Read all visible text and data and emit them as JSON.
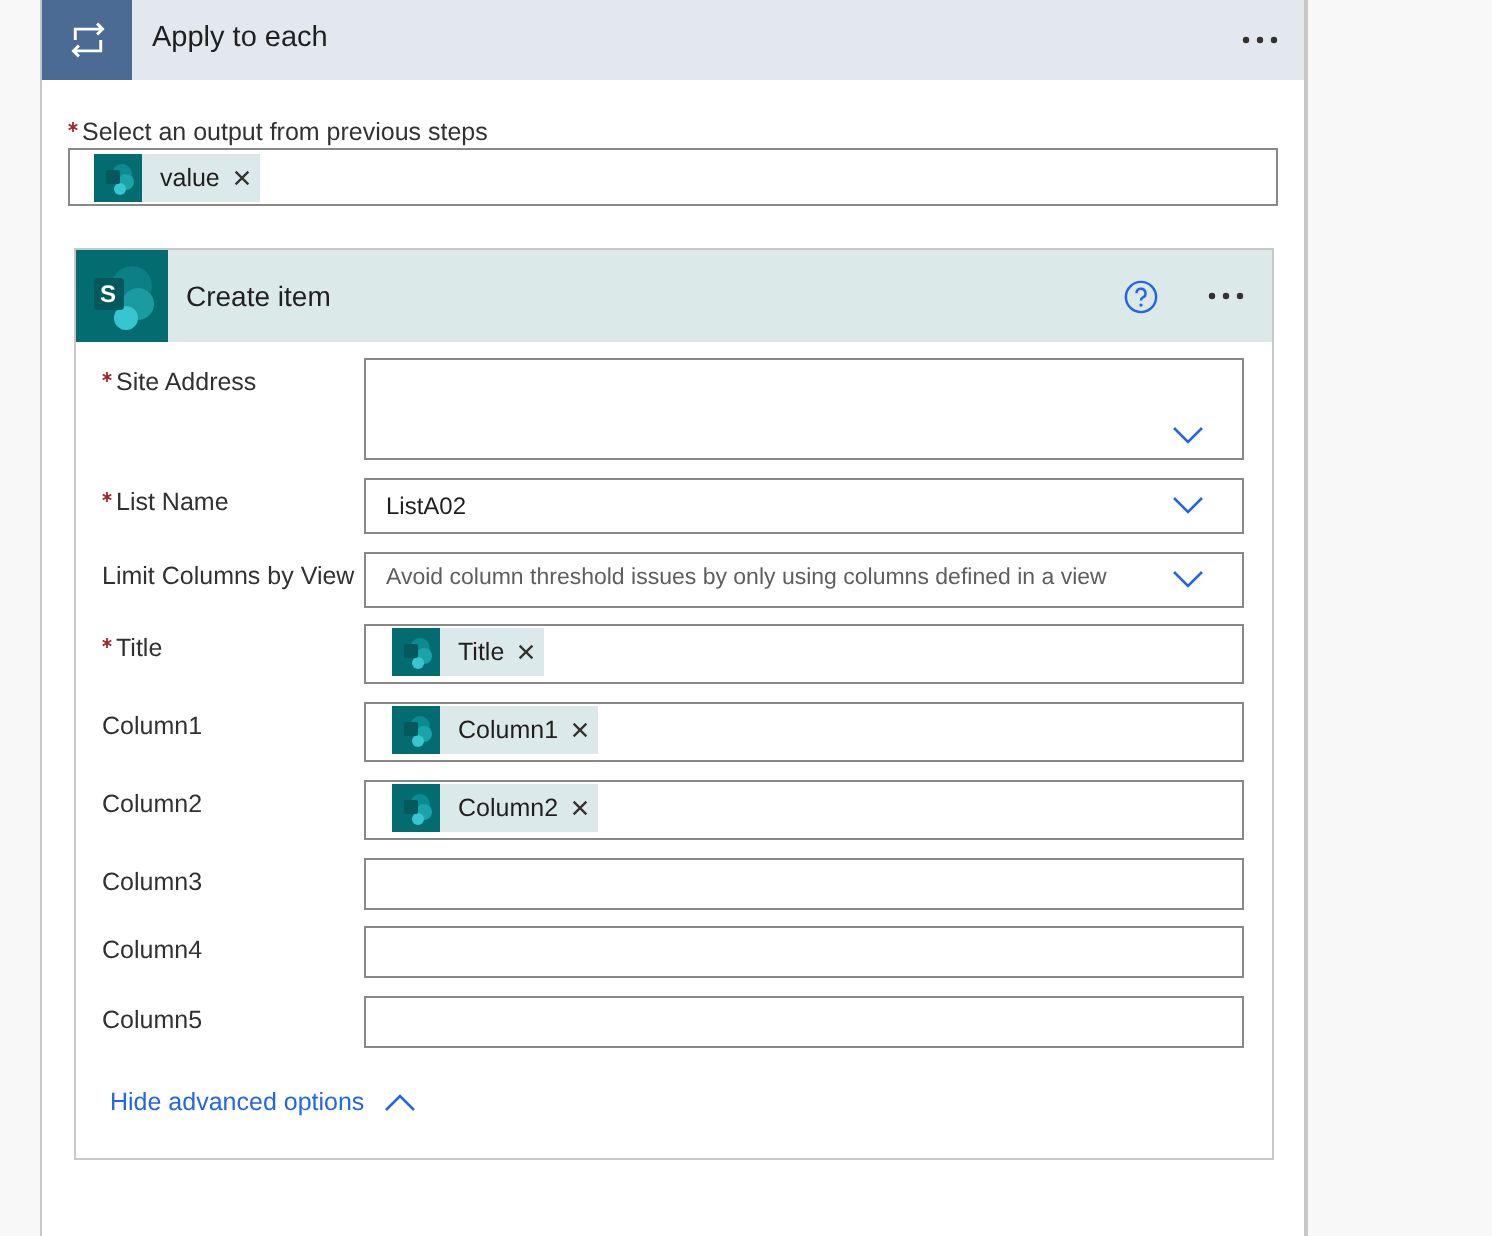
{
  "loop": {
    "title": "Apply to each"
  },
  "output_field": {
    "label": "Select an output from previous steps",
    "required": true,
    "tokens": [
      {
        "label": "value"
      }
    ]
  },
  "action": {
    "title": "Create item",
    "logo_text": "S",
    "fields": [
      {
        "label": "Site Address",
        "required": true,
        "kind": "site-picker"
      },
      {
        "label": "List Name",
        "required": true,
        "kind": "dropdown",
        "value": "ListA02"
      },
      {
        "label": "Limit Columns by View",
        "required": false,
        "kind": "dropdown",
        "placeholder": "Avoid column threshold issues by only using columns defined in a view"
      },
      {
        "label": "Title",
        "required": true,
        "kind": "tokens",
        "tokens": [
          {
            "label": "Title"
          }
        ]
      },
      {
        "label": "Column1",
        "required": false,
        "kind": "tokens",
        "tokens": [
          {
            "label": "Column1"
          }
        ]
      },
      {
        "label": "Column2",
        "required": false,
        "kind": "tokens",
        "tokens": [
          {
            "label": "Column2"
          }
        ]
      },
      {
        "label": "Column3",
        "required": false,
        "kind": "text"
      },
      {
        "label": "Column4",
        "required": false,
        "kind": "text"
      },
      {
        "label": "Column5",
        "required": false,
        "kind": "text"
      }
    ],
    "advanced_toggle": {
      "label": "Hide advanced options",
      "expanded": true
    }
  }
}
